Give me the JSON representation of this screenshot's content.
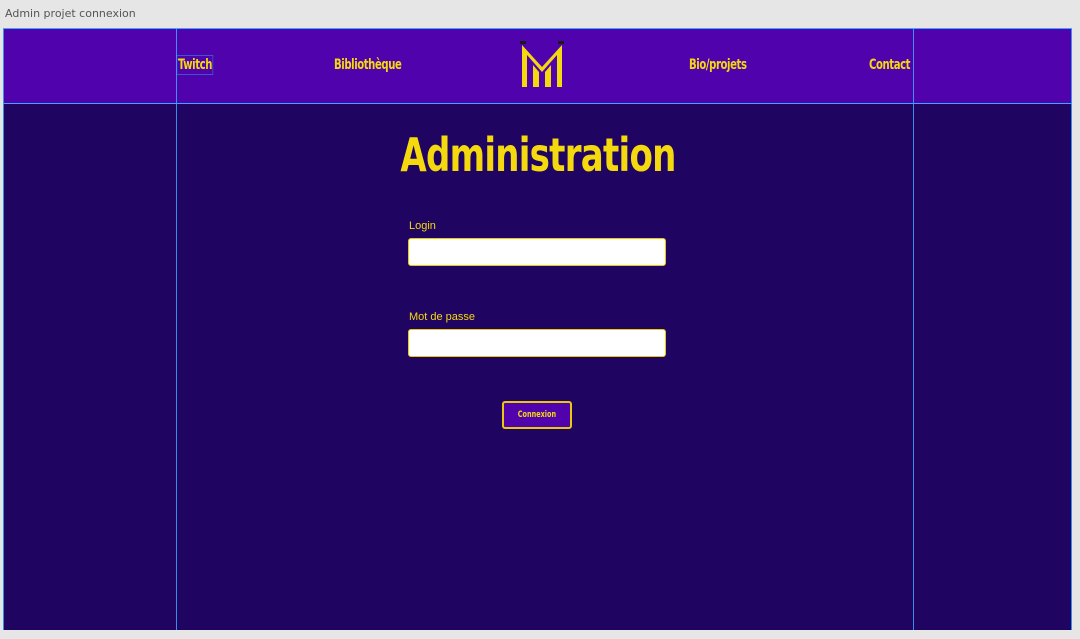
{
  "window": {
    "title": "Admin projet connexion"
  },
  "nav": {
    "links": [
      {
        "label": "Twitch"
      },
      {
        "label": "Bibliothèque"
      },
      {
        "label": "Bio/projets"
      },
      {
        "label": "Contact"
      }
    ],
    "logo_icon": "m-monogram-logo-icon"
  },
  "main": {
    "title": "Administration"
  },
  "form": {
    "login_label": "Login",
    "login_value": "",
    "password_label": "Mot de passe",
    "password_value": "",
    "submit_label": "Connexion"
  },
  "colors": {
    "nav_bg": "#5003ad",
    "page_bg": "#1f0461",
    "accent_yellow": "#f5d90f",
    "guide_blue": "#3aa8ff"
  }
}
